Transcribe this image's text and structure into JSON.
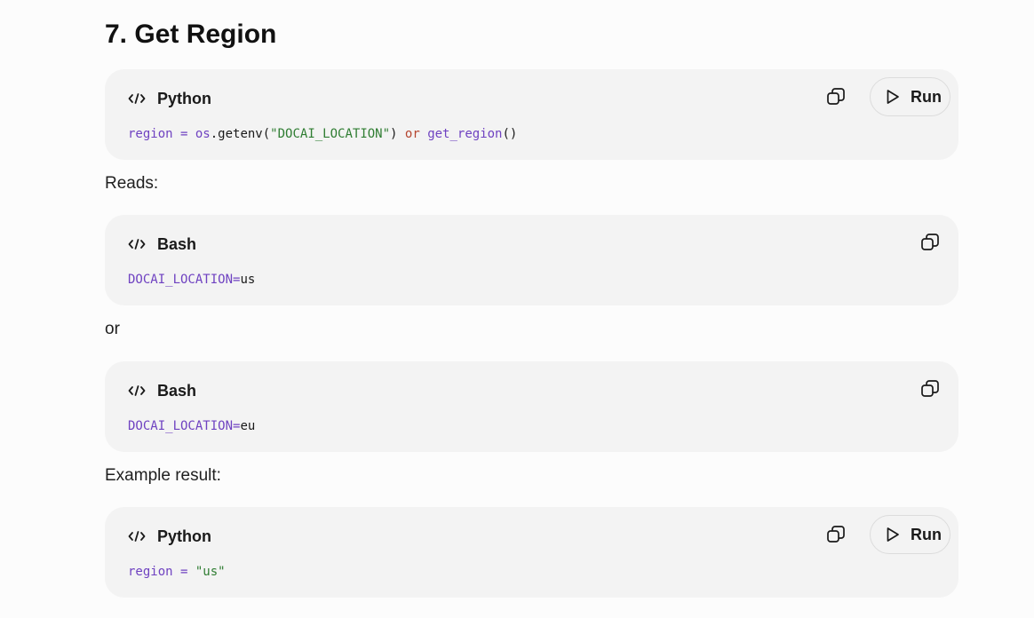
{
  "section": {
    "heading": "7. Get Region"
  },
  "prose": {
    "reads": "Reads:",
    "or": "or",
    "example_result": "Example result:"
  },
  "blocks": [
    {
      "language": "Python",
      "has_run": true,
      "run_label": "Run",
      "code": {
        "t1": "region",
        "t2": " = ",
        "t3": "os",
        "t4": ".getenv(",
        "t5": "\"DOCAI_LOCATION\"",
        "t6": ") ",
        "t7": "or",
        "t8": " ",
        "t9": "get_region",
        "t10": "()"
      }
    },
    {
      "language": "Bash",
      "has_run": false,
      "code": {
        "t1": "DOCAI_LOCATION",
        "t2": "=",
        "t3": "us"
      }
    },
    {
      "language": "Bash",
      "has_run": false,
      "code": {
        "t1": "DOCAI_LOCATION",
        "t2": "=",
        "t3": "eu"
      }
    },
    {
      "language": "Python",
      "has_run": true,
      "run_label": "Run",
      "code": {
        "t1": "region",
        "t2": " = ",
        "t3": "\"us\""
      }
    }
  ],
  "icons": {
    "language": "code-brackets-icon",
    "copy": "copy-icon",
    "run": "play-icon"
  },
  "colors": {
    "page_background": "#fcfcfc",
    "card_background": "#f3f3f3",
    "code_identifier": "#6f42c1",
    "code_string": "#2f7d32",
    "code_keyword": "#b5452f"
  }
}
